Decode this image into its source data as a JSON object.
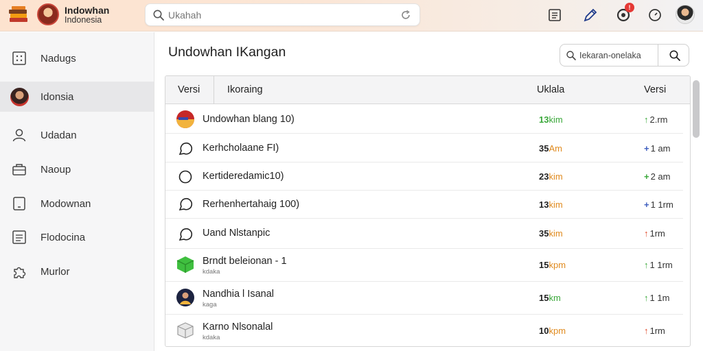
{
  "header": {
    "brand_title": "Indowhan",
    "brand_subtitle": "Indonesia",
    "search_placeholder": "Ukahah",
    "notification_count": "!"
  },
  "sidebar": {
    "items": [
      {
        "label": "Nadugs",
        "icon": "grid-icon"
      },
      {
        "label": "Idonsia",
        "icon": "avatar",
        "active": true
      },
      {
        "label": "Udadan",
        "icon": "user-icon"
      },
      {
        "label": "Naoup",
        "icon": "toolbox-icon"
      },
      {
        "label": "Modownan",
        "icon": "tablet-icon"
      },
      {
        "label": "Flodocina",
        "icon": "list-icon"
      },
      {
        "label": "Murlor",
        "icon": "puzzle-icon"
      }
    ]
  },
  "main": {
    "title": "Undowhan IKangan",
    "search_placeholder": "Iekaran-onelaka"
  },
  "table": {
    "columns": [
      "Versi",
      "Ikoraing",
      "Uklala",
      "Versi"
    ],
    "rows": [
      {
        "name": "Undowhan blang 10)",
        "sub": "",
        "num": "13",
        "unit": "kim",
        "num_color": "#3aa83a",
        "ver": "2.rm",
        "arrow": "↑",
        "arrow_color": "#3aa83a",
        "icon": "flag-badge-icon"
      },
      {
        "name": "Kerhcholaane FI)",
        "sub": "",
        "num": "35",
        "unit": "Am",
        "num_color": "#e08a1e",
        "ver": "1 am",
        "arrow": "+",
        "arrow_color": "#3f5fbf",
        "icon": "speech-bubble-icon"
      },
      {
        "name": "Kertideredamic10)",
        "sub": "",
        "num": "23",
        "unit": "kim",
        "num_color": "#e08a1e",
        "ver": "2 am",
        "arrow": "+",
        "arrow_color": "#3aa83a",
        "icon": "circle-icon"
      },
      {
        "name": "Rerhenhertahaig 100)",
        "sub": "",
        "num": "13",
        "unit": "kim",
        "num_color": "#e08a1e",
        "ver": "1 1rm",
        "arrow": "+",
        "arrow_color": "#3f5fbf",
        "icon": "speech-bubble-icon"
      },
      {
        "name": "Uand Nlstanpic",
        "sub": "",
        "num": "35",
        "unit": "kim",
        "num_color": "#e08a1e",
        "ver": "1rm",
        "arrow": "↑",
        "arrow_color": "#e04a2a",
        "icon": "speech-bubble-icon"
      },
      {
        "name": "Brndt beleionan - 1",
        "sub": "kdaka",
        "num": "15",
        "unit": "kpm",
        "num_color": "#e08a1e",
        "ver": "1 1rm",
        "arrow": "↑",
        "arrow_color": "#3aa83a",
        "icon": "green-cube-icon"
      },
      {
        "name": "Nandhia l Isanal",
        "sub": "kaga",
        "num": "15",
        "unit": "km",
        "num_color": "#3aa83a",
        "ver": "1 1m",
        "arrow": "↑",
        "arrow_color": "#3aa83a",
        "icon": "person-avatar-icon"
      },
      {
        "name": "Karno Nlsonalal",
        "sub": "kdaka",
        "num": "10",
        "unit": "kpm",
        "num_color": "#e08a1e",
        "ver": "1rm",
        "arrow": "↑",
        "arrow_color": "#e04a2a",
        "icon": "box-icon"
      }
    ]
  }
}
